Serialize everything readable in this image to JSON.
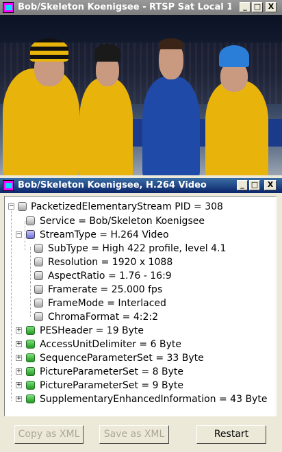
{
  "main_window": {
    "title": "Bob/Skeleton Koenigsee - RTSP Sat Local 1 ...",
    "minimize": "_",
    "maximize": "□",
    "close": "X"
  },
  "inner_window": {
    "title": "Bob/Skeleton Koenigsee, H.264 Video",
    "minimize": "_",
    "maximize": "□",
    "close": "X"
  },
  "tree": {
    "root": "PacketizedElementaryStream PID = 308",
    "service": "Service = Bob/Skeleton Koenigsee",
    "stream_type": "StreamType = H.264 Video",
    "details": [
      "SubType = High 422 profile, level 4.1",
      "Resolution = 1920 x 1088",
      "AspectRatio = 1.76 - 16:9",
      "Framerate = 25.000 fps",
      "FrameMode = Interlaced",
      "ChromaFormat = 4:2:2"
    ],
    "children": [
      "PESHeader = 19 Byte",
      "AccessUnitDelimiter = 6 Byte",
      "SequenceParameterSet = 33 Byte",
      "PictureParameterSet = 8 Byte",
      "PictureParameterSet = 9 Byte",
      "SupplementaryEnhancedInformation = 43 Byte"
    ]
  },
  "buttons": {
    "copy_xml": "Copy as XML",
    "save_xml": "Save as XML",
    "restart": "Restart"
  }
}
